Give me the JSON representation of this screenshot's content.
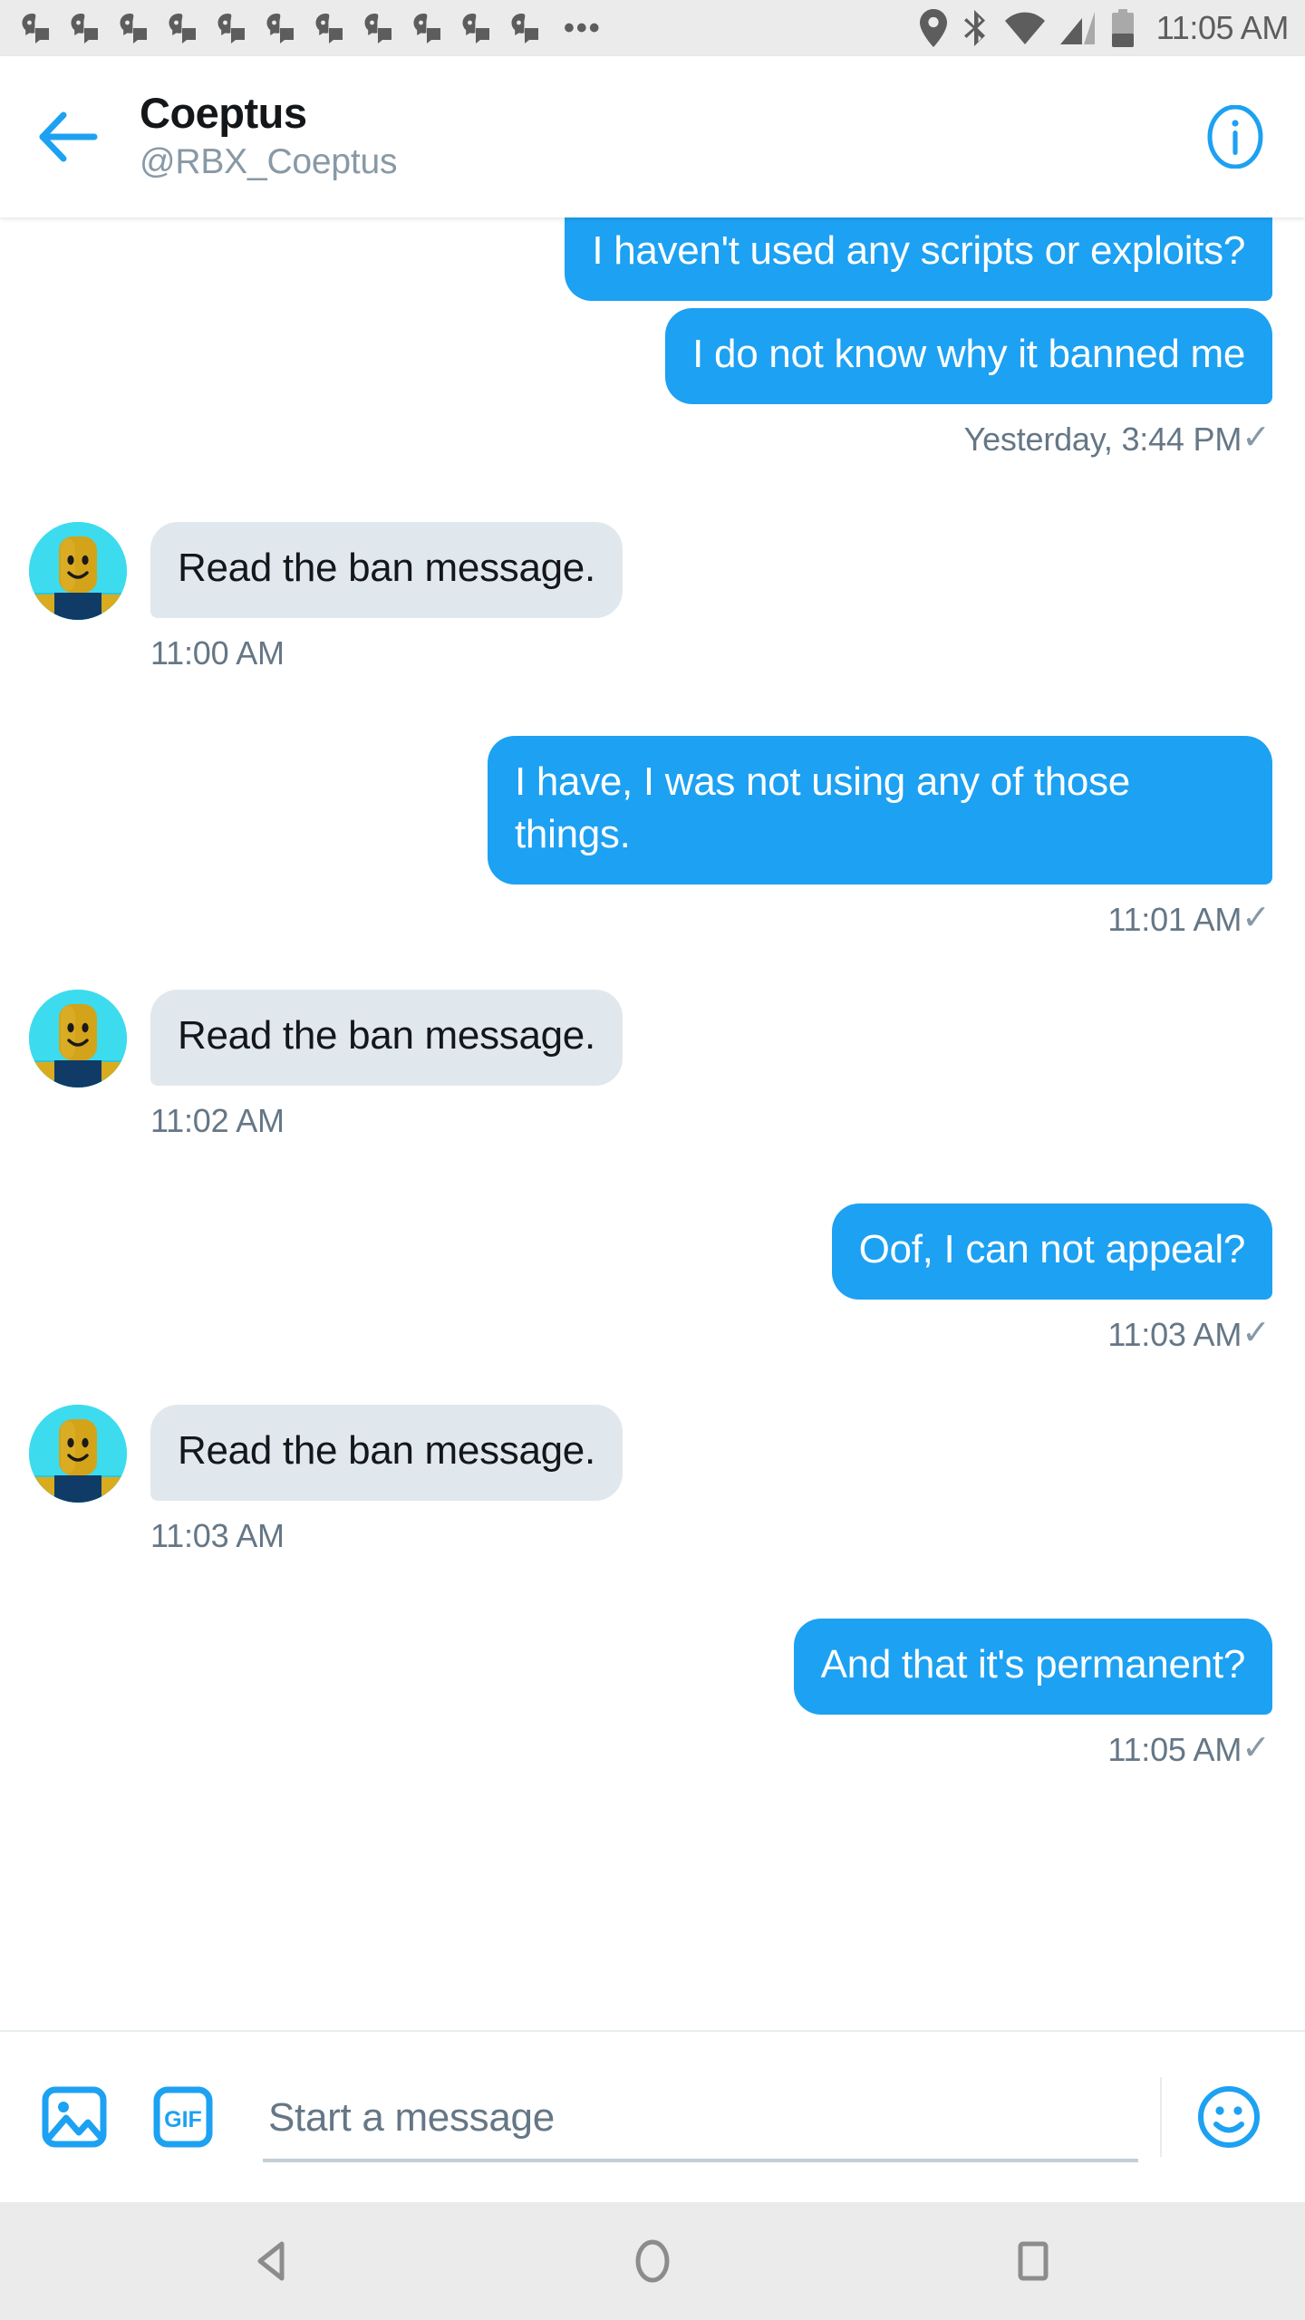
{
  "status_bar": {
    "notification_icon_count": 11,
    "notification_icon_name": "chat-notification-icon",
    "overflow_dots": "•••",
    "icons": [
      "location-pin-icon",
      "bluetooth-icon",
      "wifi-icon",
      "cellular-signal-icon",
      "battery-icon"
    ],
    "clock": "11:05 AM",
    "background_color": "#EBEBEB",
    "icon_color": "#5D5D5D"
  },
  "header": {
    "back_label": "Back",
    "name": "Coeptus",
    "handle": "@RBX_Coeptus",
    "info_label": "Conversation info",
    "accent_color": "#1DA1F2",
    "name_color": "#14171A",
    "handle_color": "#8899A6"
  },
  "thread": {
    "outgoing_bubble_color": "#1DA1F2",
    "incoming_bubble_color": "#E1E8ED",
    "meta_color": "#657786",
    "messages": [
      {
        "id": "m1",
        "direction": "out",
        "text": "I haven't used any scripts or exploits?",
        "clipped": true,
        "meta": null,
        "check": null
      },
      {
        "id": "m2",
        "direction": "out",
        "text": "I do not know why it banned me",
        "clipped": false,
        "meta": "Yesterday, 3:44 PM",
        "check": "✓"
      },
      {
        "id": "m3",
        "direction": "in",
        "text": "Read the ban message.",
        "clipped": false,
        "meta": "11:00 AM",
        "check": null
      },
      {
        "id": "m4",
        "direction": "out",
        "text": "I have, I was not using any of those things.",
        "clipped": false,
        "meta": "11:01 AM",
        "check": "✓"
      },
      {
        "id": "m5",
        "direction": "in",
        "text": "Read the ban message.",
        "clipped": false,
        "meta": "11:02 AM",
        "check": null
      },
      {
        "id": "m6",
        "direction": "out",
        "text": "Oof, I can not appeal?",
        "clipped": false,
        "meta": "11:03 AM",
        "check": "✓"
      },
      {
        "id": "m7",
        "direction": "in",
        "text": "Read the ban message.",
        "clipped": false,
        "meta": "11:03 AM",
        "check": null
      },
      {
        "id": "m8",
        "direction": "out",
        "text": "And that it's permanent?",
        "clipped": false,
        "meta": "11:05 AM",
        "check": "✓"
      }
    ],
    "avatar": {
      "name": "roblox-avatar",
      "background_color": "#3DDBEE",
      "head_color": "#D3A319",
      "torso_color": "#0F3B66",
      "face_color": "#1A1A1A"
    }
  },
  "composer": {
    "photo_icon": "image-icon",
    "gif_icon": "gif-icon",
    "gif_label": "GIF",
    "input_value": "",
    "input_placeholder": "Start a message",
    "emoji_icon": "emoji-smiley-icon",
    "accent_color": "#1DA1F2",
    "placeholder_color": "#657786"
  },
  "nav_bar": {
    "background_color": "#EBEBEB",
    "icon_color": "#8C8C8C",
    "buttons": [
      {
        "name": "android-back-button",
        "label": "Back"
      },
      {
        "name": "android-home-button",
        "label": "Home"
      },
      {
        "name": "android-recents-button",
        "label": "Recents"
      }
    ]
  }
}
